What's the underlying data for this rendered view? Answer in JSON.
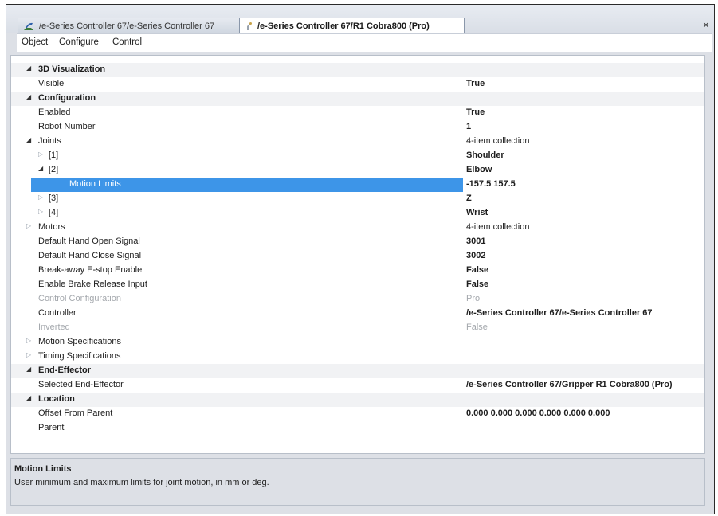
{
  "tabs": [
    {
      "label": "/e-Series Controller 67/e-Series Controller 67"
    },
    {
      "label": "/e-Series Controller 67/R1 Cobra800 (Pro)"
    }
  ],
  "close_glyph": "×",
  "menu": [
    "Object",
    "Configure",
    "Control"
  ],
  "rows": [
    {
      "name": "3D Visualization",
      "value": ""
    },
    {
      "name": "Visible",
      "value": "True"
    },
    {
      "name": "Configuration",
      "value": ""
    },
    {
      "name": "Enabled",
      "value": "True"
    },
    {
      "name": "Robot Number",
      "value": "1"
    },
    {
      "name": "Joints",
      "value": "4-item collection"
    },
    {
      "name": "[1]",
      "value": "Shoulder"
    },
    {
      "name": "[2]",
      "value": "Elbow"
    },
    {
      "name": "Motion Limits",
      "value": "-157.5 157.5"
    },
    {
      "name": "[3]",
      "value": "Z"
    },
    {
      "name": "[4]",
      "value": "Wrist"
    },
    {
      "name": "Motors",
      "value": "4-item collection"
    },
    {
      "name": "Default Hand Open Signal",
      "value": "3001"
    },
    {
      "name": "Default Hand Close Signal",
      "value": "3002"
    },
    {
      "name": "Break-away E-stop Enable",
      "value": "False"
    },
    {
      "name": "Enable Brake Release Input",
      "value": "False"
    },
    {
      "name": "Control Configuration",
      "value": "Pro"
    },
    {
      "name": "Controller",
      "value": "/e-Series Controller 67/e-Series Controller 67"
    },
    {
      "name": "Inverted",
      "value": "False"
    },
    {
      "name": "Motion Specifications",
      "value": ""
    },
    {
      "name": "Timing Specifications",
      "value": ""
    },
    {
      "name": "End-Effector",
      "value": ""
    },
    {
      "name": "Selected End-Effector",
      "value": "/e-Series Controller 67/Gripper R1 Cobra800 (Pro)"
    },
    {
      "name": "Location",
      "value": ""
    },
    {
      "name": "Offset From Parent",
      "value": "0.000 0.000 0.000 0.000 0.000 0.000"
    },
    {
      "name": "Parent",
      "value": ""
    }
  ],
  "description": {
    "title": "Motion Limits",
    "text": "User minimum and maximum limits for joint motion, in mm or deg."
  },
  "colors": {
    "selection": "#3d95e8",
    "category_background": "#f1f2f4",
    "disabled_text": "#a4a8ad"
  }
}
